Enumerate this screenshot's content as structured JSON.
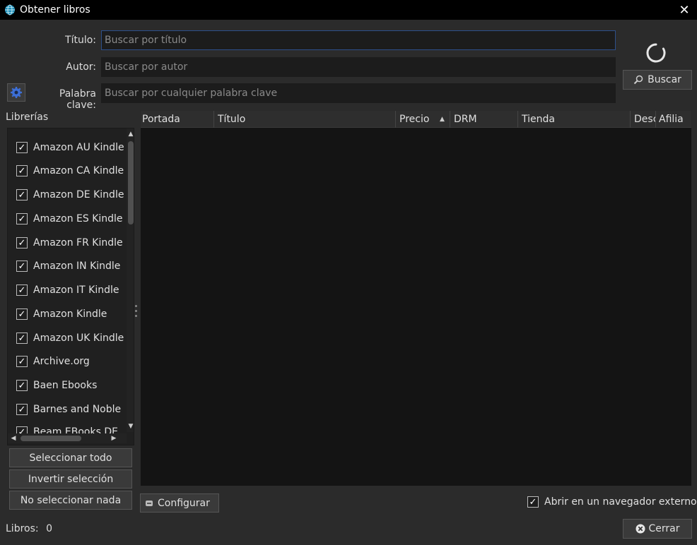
{
  "window": {
    "title": "Obtener libros",
    "close_glyph": "✕"
  },
  "search": {
    "title_label": "Título:",
    "title_placeholder": "Buscar por título",
    "author_label": "Autor:",
    "author_placeholder": "Buscar por autor",
    "keyword_label": "Palabra clave:",
    "keyword_placeholder": "Buscar por cualquier palabra clave",
    "search_button": "Buscar"
  },
  "libraries": {
    "heading": "Librerías",
    "items": [
      {
        "label": "Amazon AU Kindle",
        "checked": true
      },
      {
        "label": "Amazon CA Kindle",
        "checked": true
      },
      {
        "label": "Amazon DE Kindle",
        "checked": true
      },
      {
        "label": "Amazon ES Kindle",
        "checked": true
      },
      {
        "label": "Amazon FR Kindle",
        "checked": true
      },
      {
        "label": "Amazon IN Kindle",
        "checked": true
      },
      {
        "label": "Amazon IT Kindle",
        "checked": true
      },
      {
        "label": "Amazon Kindle",
        "checked": true
      },
      {
        "label": "Amazon UK Kindle",
        "checked": true
      },
      {
        "label": "Archive.org",
        "checked": true
      },
      {
        "label": "Baen Ebooks",
        "checked": true
      },
      {
        "label": "Barnes and Noble",
        "checked": true
      },
      {
        "label": "Beam EBooks DE",
        "checked": true
      }
    ],
    "select_all": "Seleccionar todo",
    "invert": "Invertir selección",
    "select_none": "No seleccionar nada"
  },
  "table": {
    "columns": [
      "Portada",
      "Título",
      "Precio",
      "DRM",
      "Tienda",
      "Desc",
      "Afilia"
    ]
  },
  "footer": {
    "configure": "Configurar",
    "open_external": "Abrir en un navegador externo",
    "open_external_checked": true,
    "books_label": "Libros:",
    "books_count": "0",
    "close": "Cerrar"
  },
  "colors": {
    "background": "#2b2b2b",
    "titlebar": "#000000",
    "table_bg": "#141414",
    "focus_border": "#2d4f8a"
  }
}
